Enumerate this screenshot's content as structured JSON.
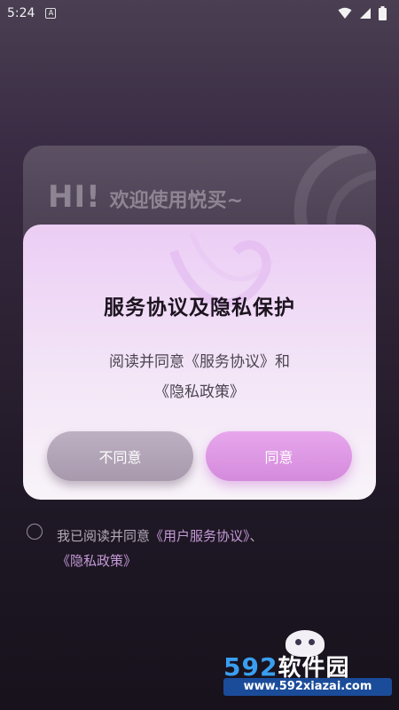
{
  "status_bar": {
    "time": "5:24",
    "notification_icon": "A",
    "icons": [
      "wifi-icon",
      "signal-icon",
      "battery-icon"
    ]
  },
  "login_card": {
    "hi": "HI!",
    "welcome": "欢迎使用悦买~"
  },
  "dialog": {
    "title": "服务协议及隐私保护",
    "body_line1": "阅读并同意《服务协议》和",
    "body_line2": "《隐私政策》",
    "disagree_label": "不同意",
    "agree_label": "同意"
  },
  "agreement": {
    "prefix": "我已阅读并同意",
    "user_agreement_link": "《用户服务协议》",
    "separator": "、",
    "privacy_link": "《隐私政策》",
    "checked": false
  },
  "watermark": {
    "logo_num": "592",
    "logo_cn": "软件园",
    "url": "www.592xiazai.com"
  },
  "colors": {
    "accent": "#d48adc",
    "link": "#c49ad6",
    "dialog_top": "#eccdf5"
  }
}
